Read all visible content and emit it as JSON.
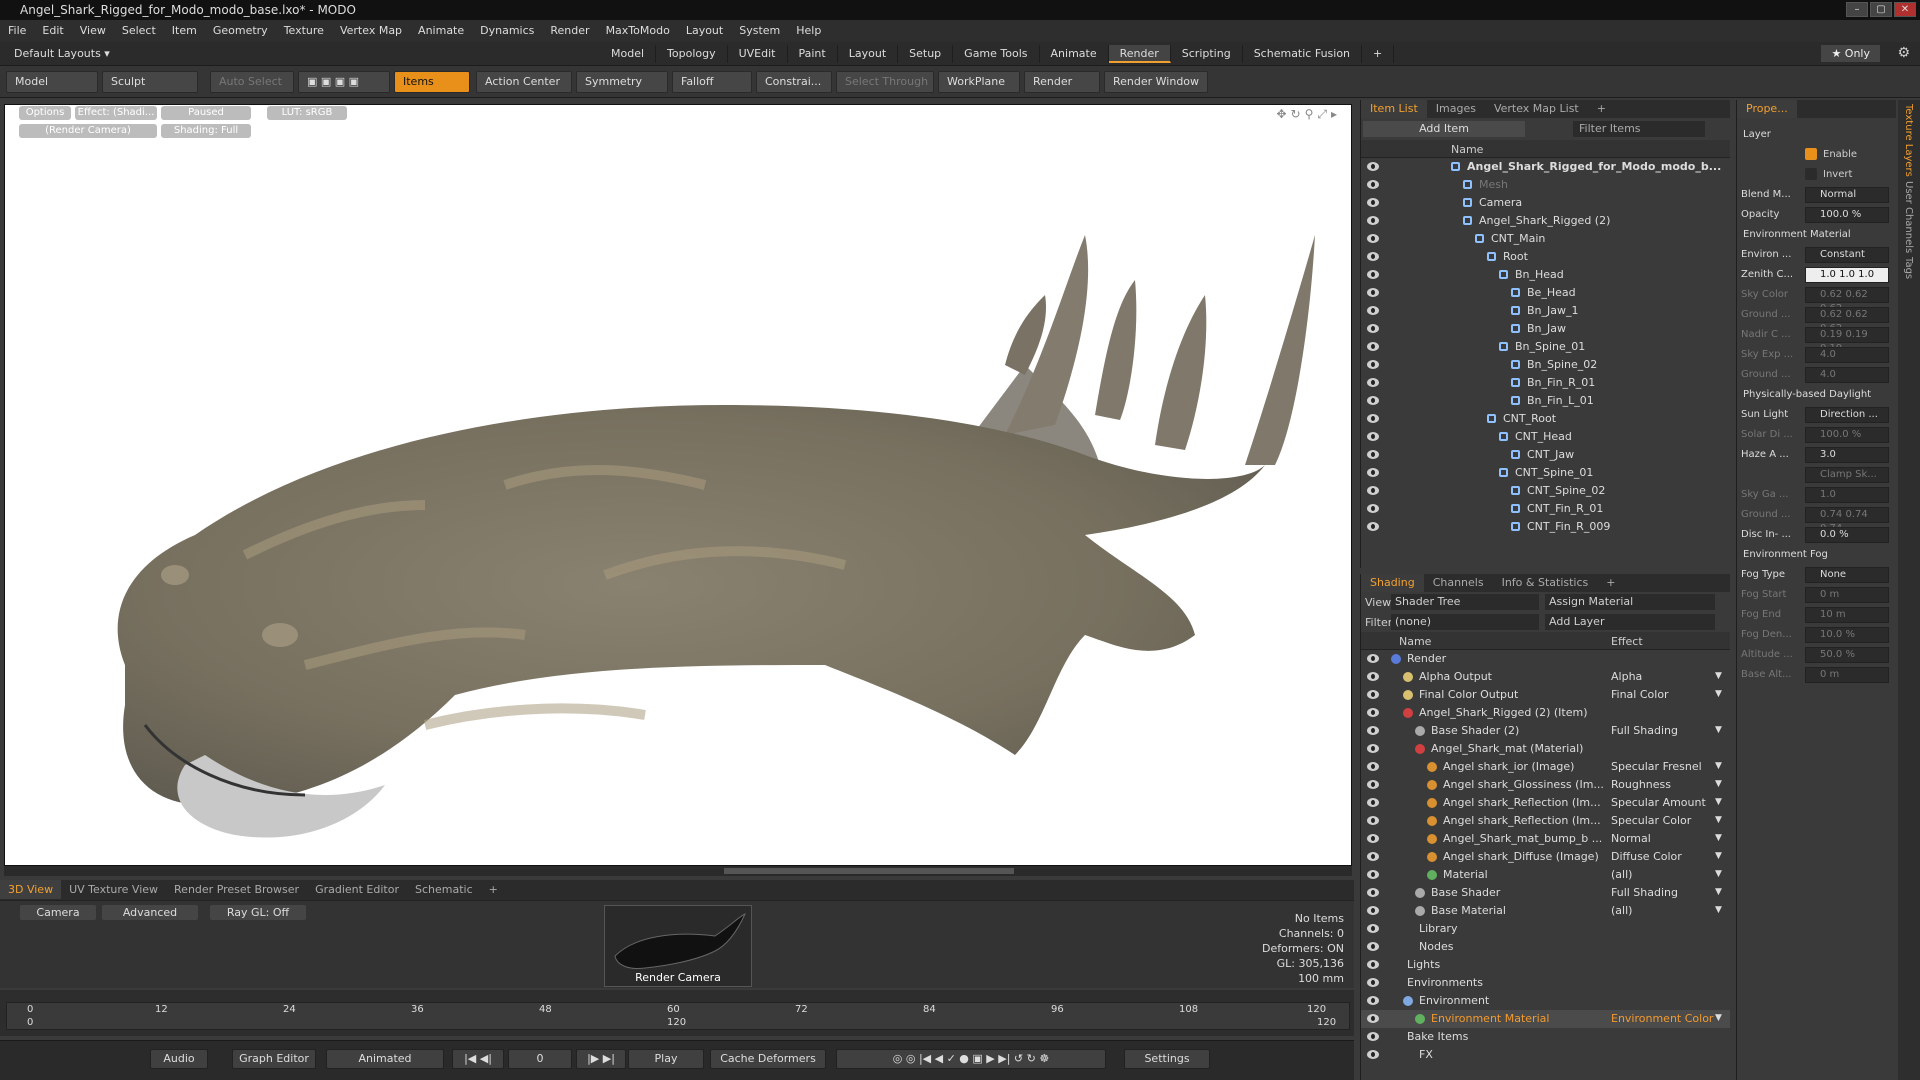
{
  "title": "Angel_Shark_Rigged_for_Modo_modo_base.lxo* - MODO",
  "menu": [
    "File",
    "Edit",
    "View",
    "Select",
    "Item",
    "Geometry",
    "Texture",
    "Vertex Map",
    "Animate",
    "Dynamics",
    "Render",
    "MaxToModo",
    "Layout",
    "System",
    "Help"
  ],
  "layouts": {
    "default": "Default Layouts ▾",
    "tabs": [
      "Model",
      "Topology",
      "UVEdit",
      "Paint",
      "Layout",
      "Setup",
      "Game Tools",
      "Animate",
      "Render",
      "Scripting",
      "Schematic Fusion",
      "+"
    ],
    "active": "Render",
    "only": "★ Only"
  },
  "toolbar": {
    "model": "Model",
    "sculpt": "Sculpt",
    "auto_select": "Auto Select",
    "items": "Items",
    "action_center": "Action Center",
    "symmetry": "Symmetry",
    "falloff": "Falloff",
    "constrain": "Constrai...",
    "select_through": "Select Through",
    "workplane": "WorkPlane",
    "render": "Render",
    "render_window": "Render Window"
  },
  "viewport": {
    "options": "Options",
    "effect": "Effect: (Shadi...",
    "paused": "Paused",
    "lut": "LUT: sRGB",
    "camera": "(Render Camera)",
    "shading": "Shading: Full"
  },
  "bottom_tabs": [
    "3D View",
    "UV Texture View",
    "Render Preset Browser",
    "Gradient Editor",
    "Schematic",
    "+"
  ],
  "bottom_view": {
    "camera": "Camera",
    "advanced": "Advanced",
    "raygl": "Ray GL: Off",
    "thumb_label": "Render Camera",
    "stats": [
      "No Items",
      "Channels: 0",
      "Deformers: ON",
      "GL: 305,136",
      "100 mm"
    ]
  },
  "timeline": {
    "ticks": [
      "0",
      "12",
      "24",
      "36",
      "48",
      "60",
      "72",
      "84",
      "96",
      "108",
      "120"
    ],
    "sub": [
      "0",
      "120",
      "120"
    ]
  },
  "transport": {
    "audio": "Audio",
    "graph_editor": "Graph Editor",
    "mode": "Animated",
    "frame": "0",
    "play": "Play",
    "cache": "Cache Deformers",
    "settings": "Settings"
  },
  "itemlist": {
    "tabs": [
      "Item List",
      "Images",
      "Vertex Map List",
      "+"
    ],
    "add_item": "Add Item",
    "filter": "Filter Items",
    "name_col": "Name",
    "rows": [
      {
        "n": "Angel_Shark_Rigged_for_Modo_modo_b...",
        "d": 6,
        "b": true
      },
      {
        "n": "Mesh",
        "d": 7,
        "dim": true
      },
      {
        "n": "Camera",
        "d": 7
      },
      {
        "n": "Angel_Shark_Rigged (2)",
        "d": 7
      },
      {
        "n": "CNT_Main",
        "d": 8
      },
      {
        "n": "Root",
        "d": 9
      },
      {
        "n": "Bn_Head",
        "d": 10
      },
      {
        "n": "Be_Head",
        "d": 11
      },
      {
        "n": "Bn_Jaw_1",
        "d": 11
      },
      {
        "n": "Bn_Jaw",
        "d": 11
      },
      {
        "n": "Bn_Spine_01",
        "d": 10
      },
      {
        "n": "Bn_Spine_02",
        "d": 11
      },
      {
        "n": "Bn_Fin_R_01",
        "d": 11
      },
      {
        "n": "Bn_Fin_L_01",
        "d": 11
      },
      {
        "n": "CNT_Root",
        "d": 9
      },
      {
        "n": "CNT_Head",
        "d": 10
      },
      {
        "n": "CNT_Jaw",
        "d": 11
      },
      {
        "n": "CNT_Spine_01",
        "d": 10
      },
      {
        "n": "CNT_Spine_02",
        "d": 11
      },
      {
        "n": "CNT_Fin_R_01",
        "d": 11
      },
      {
        "n": "CNT_Fin_R_009",
        "d": 11
      }
    ]
  },
  "shading": {
    "tabs": [
      "Shading",
      "Channels",
      "Info & Statistics",
      "+"
    ],
    "view_label": "View",
    "view_val": "Shader Tree",
    "assign": "Assign Material",
    "filter_label": "Filter",
    "filter_val": "(none)",
    "add_layer": "Add Layer",
    "name_col": "Name",
    "effect_col": "Effect",
    "rows": [
      {
        "n": "Render",
        "e": "",
        "d": 1,
        "c": "#5a7ad8"
      },
      {
        "n": "Alpha Output",
        "e": "Alpha",
        "d": 2,
        "c": "#d8c070"
      },
      {
        "n": "Final Color Output",
        "e": "Final Color",
        "d": 2,
        "c": "#d8c070"
      },
      {
        "n": "Angel_Shark_Rigged (2) (Item)",
        "e": "",
        "d": 2,
        "c": "#d04040"
      },
      {
        "n": "Base Shader (2)",
        "e": "Full Shading",
        "d": 3,
        "c": "#aaaaaa"
      },
      {
        "n": "Angel_Shark_mat (Material)",
        "e": "",
        "d": 3,
        "c": "#d04040"
      },
      {
        "n": "Angel shark_ior (Image)",
        "e": "Specular Fresnel",
        "d": 4,
        "c": "#d89030"
      },
      {
        "n": "Angel shark_Glossiness (Im...",
        "e": "Roughness",
        "d": 4,
        "c": "#d89030"
      },
      {
        "n": "Angel shark_Reflection (Im...",
        "e": "Specular Amount",
        "d": 4,
        "c": "#d89030"
      },
      {
        "n": "Angel shark_Reflection (Im...",
        "e": "Specular Color",
        "d": 4,
        "c": "#d89030"
      },
      {
        "n": "Angel_Shark_mat_bump_b ...",
        "e": "Normal",
        "d": 4,
        "c": "#d89030"
      },
      {
        "n": "Angel shark_Diffuse (Image)",
        "e": "Diffuse Color",
        "d": 4,
        "c": "#d89030"
      },
      {
        "n": "Material",
        "e": "(all)",
        "d": 4,
        "c": "#60b060"
      },
      {
        "n": "Base Shader",
        "e": "Full Shading",
        "d": 3,
        "c": "#aaaaaa"
      },
      {
        "n": "Base Material",
        "e": "(all)",
        "d": 3,
        "c": "#aaaaaa"
      },
      {
        "n": "Library",
        "e": "",
        "d": 2,
        "c": ""
      },
      {
        "n": "Nodes",
        "e": "",
        "d": 2,
        "c": ""
      },
      {
        "n": "Lights",
        "e": "",
        "d": 1,
        "c": ""
      },
      {
        "n": "Environments",
        "e": "",
        "d": 1,
        "c": ""
      },
      {
        "n": "Environment",
        "e": "",
        "d": 2,
        "c": "#7ea8e0"
      },
      {
        "n": "Environment Material",
        "e": "Environment Color",
        "d": 3,
        "c": "#60b060",
        "sel": true
      },
      {
        "n": "Bake Items",
        "e": "",
        "d": 1,
        "c": ""
      },
      {
        "n": "FX",
        "e": "",
        "d": 2,
        "c": ""
      }
    ]
  },
  "props": {
    "tab": "Prope...",
    "layer": "Layer",
    "enable": "Enable",
    "invert": "Invert",
    "rows": [
      {
        "l": "Blend M...",
        "v": "Normal"
      },
      {
        "l": "Opacity",
        "v": "100.0 %"
      },
      {
        "sec": "Environment Material"
      },
      {
        "l": "Environ ...",
        "v": "Constant"
      },
      {
        "l": "Zenith C...",
        "v": "1.0  1.0  1.0",
        "hi": true
      },
      {
        "l": "Sky Color",
        "v": "0.62 0.62 0.62",
        "dis": true
      },
      {
        "l": "Ground ...",
        "v": "0.62 0.62 0.62",
        "dis": true
      },
      {
        "l": "Nadir C ...",
        "v": "0.19 0.19 0.19",
        "dis": true
      },
      {
        "l": "Sky Exp ...",
        "v": "4.0",
        "dis": true
      },
      {
        "l": "Ground ...",
        "v": "4.0",
        "dis": true
      },
      {
        "sec": "Physically-based Daylight"
      },
      {
        "l": "Sun Light",
        "v": "Direction ..."
      },
      {
        "l": "Solar Di ...",
        "v": "100.0 %",
        "dis": true
      },
      {
        "l": "Haze A ...",
        "v": "3.0"
      },
      {
        "l": "",
        "v": "Clamp Sk...",
        "dis": true
      },
      {
        "l": "Sky Ga ...",
        "v": "1.0",
        "dis": true
      },
      {
        "l": "Ground ...",
        "v": "0.74 0.74 0.74",
        "dis": true
      },
      {
        "l": "Disc In- ...",
        "v": "0.0 %"
      },
      {
        "sec": "Environment Fog"
      },
      {
        "l": "Fog Type",
        "v": "None"
      },
      {
        "l": "Fog Start",
        "v": "0 m",
        "dis": true
      },
      {
        "l": "Fog End",
        "v": "10 m",
        "dis": true
      },
      {
        "l": "Fog Den...",
        "v": "10.0 %",
        "dis": true
      },
      {
        "l": "Altitude ...",
        "v": "50.0 %",
        "dis": true
      },
      {
        "l": "Base Alt...",
        "v": "0 m",
        "dis": true
      }
    ]
  },
  "side_tabs": [
    "Texture Layers",
    "User Channels",
    "Tags"
  ]
}
